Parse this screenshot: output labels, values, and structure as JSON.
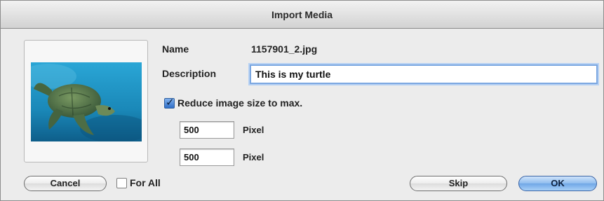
{
  "window": {
    "title": "Import Media"
  },
  "fields": {
    "name_label": "Name",
    "name_value": "1157901_2.jpg",
    "description_label": "Description",
    "description_value": "This is my turtle"
  },
  "reduce": {
    "label": "Reduce image size to max.",
    "checked": true,
    "width_value": "500",
    "height_value": "500",
    "unit_1": "Pixel",
    "unit_2": "Pixel"
  },
  "footer": {
    "cancel_label": "Cancel",
    "for_all_label": "For All",
    "for_all_checked": false,
    "skip_label": "Skip",
    "ok_label": "OK"
  },
  "preview": {
    "icon": "turtle-photo",
    "ocean_color": "#1f8fbf",
    "turtle_color": "#4f7a52"
  }
}
